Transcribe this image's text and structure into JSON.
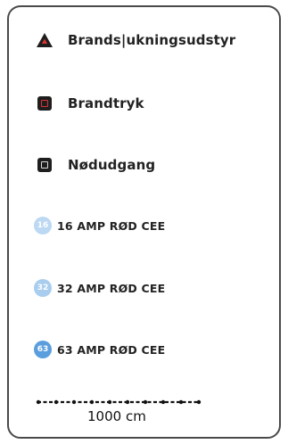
{
  "legend": {
    "items": [
      {
        "label": "Brands|ukningsudstyr",
        "icon": "warning-triangle-icon"
      },
      {
        "label": "Brandtryk",
        "icon": "fire-pressure-icon"
      },
      {
        "label": "Nødudgang",
        "icon": "emergency-exit-icon"
      },
      {
        "label": "16 AMP RØD CEE",
        "icon": "power-outlet-16-icon",
        "badge": "16",
        "color": "#bcd8f2"
      },
      {
        "label": "32 AMP RØD CEE",
        "icon": "power-outlet-32-icon",
        "badge": "32",
        "color": "#a9cdee"
      },
      {
        "label": "63 AMP RØD CEE",
        "icon": "power-outlet-63-icon",
        "badge": "63",
        "color": "#5a9ede"
      }
    ],
    "scale_label": "1000 cm"
  }
}
